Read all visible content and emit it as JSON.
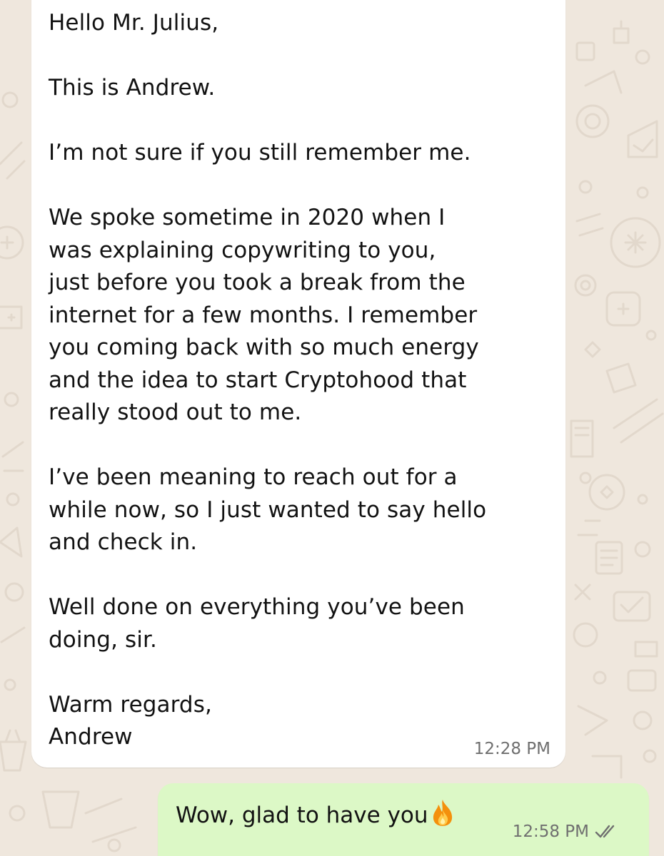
{
  "chat": {
    "incoming_message": {
      "lines": [
        "Hello Mr. Julius,",
        "",
        "This is Andrew.",
        "",
        "I’m not sure if you still remember me.",
        "",
        "We spoke sometime in 2020 when I",
        "was explaining copywriting to you,",
        "just before you took a break from the",
        "internet for a few months. I remember",
        "you coming back with so much energy",
        "and the idea to start Cryptohood that",
        "really stood out to me.",
        "",
        "I’ve been meaning to reach out for a",
        "while now, so I just wanted to say hello",
        "and check in.",
        "",
        "Well done on everything you’ve been",
        "doing, sir.",
        "",
        "Warm regards,",
        "Andrew"
      ],
      "time": "12:28 PM"
    },
    "outgoing_message": {
      "text": "Wow, glad to have you",
      "emoji_icon": "fire-icon",
      "time": "12:58 PM",
      "status_icon": "double-check-icon"
    }
  },
  "colors": {
    "wallpaper": "#efe7dd",
    "wallpaper_doodle": "#e2d8cc",
    "incoming_bubble": "#ffffff",
    "outgoing_bubble": "#dcf8c6",
    "text": "#121212",
    "timestamp": "#6f6f6f"
  }
}
